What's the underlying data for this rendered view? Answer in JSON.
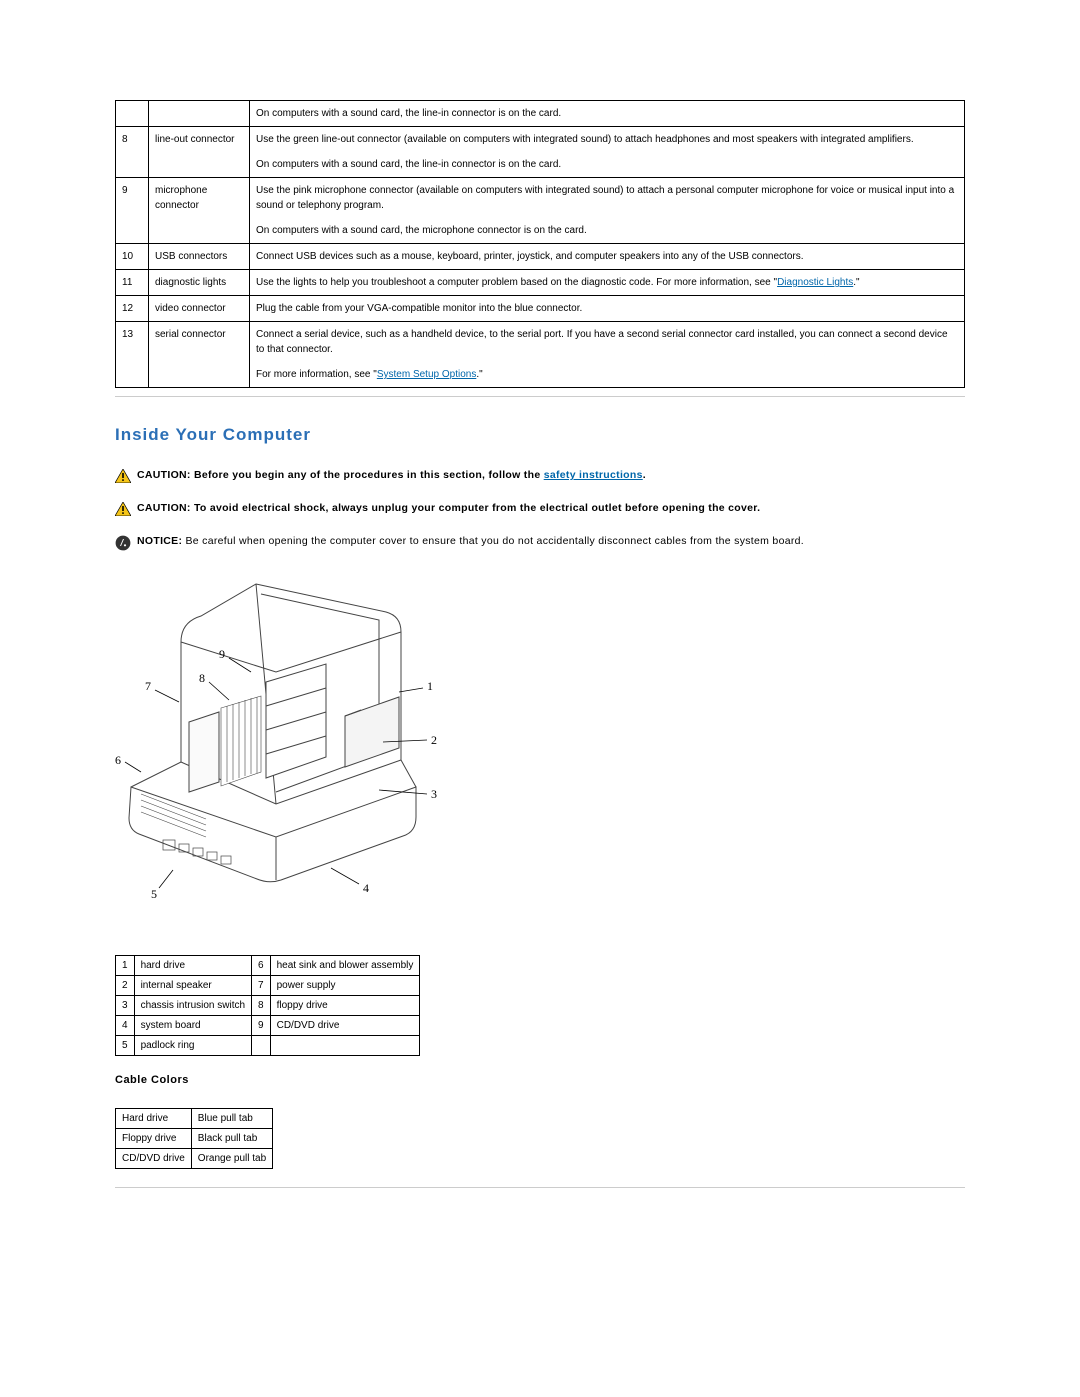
{
  "connector_rows": [
    {
      "num": "",
      "label": "",
      "desc_parts": [
        {
          "t": "text",
          "v": "On computers with a sound card, the line-in connector is on the card."
        }
      ]
    },
    {
      "num": "8",
      "label": "line-out connector",
      "desc_parts": [
        {
          "t": "text",
          "v": "Use the green line-out connector (available on computers with integrated sound) to attach headphones and most speakers with integrated amplifiers."
        },
        {
          "t": "br"
        },
        {
          "t": "text",
          "v": "On computers with a sound card, the line-in connector is on the card."
        }
      ]
    },
    {
      "num": "9",
      "label": "microphone connector",
      "desc_parts": [
        {
          "t": "text",
          "v": "Use the pink microphone connector (available on computers with integrated sound) to attach a personal computer microphone for voice or musical input into a sound or telephony program."
        },
        {
          "t": "br"
        },
        {
          "t": "text",
          "v": "On computers with a sound card, the microphone connector is on the card."
        }
      ]
    },
    {
      "num": "10",
      "label": "USB connectors",
      "desc_parts": [
        {
          "t": "text",
          "v": "Connect USB devices such as a mouse, keyboard, printer, joystick, and computer speakers into any of the USB connectors."
        }
      ]
    },
    {
      "num": "11",
      "label": "diagnostic lights",
      "desc_parts": [
        {
          "t": "text",
          "v": "Use the lights to help you troubleshoot a computer problem based on the diagnostic code. For more information, see \""
        },
        {
          "t": "link",
          "v": "Diagnostic Lights"
        },
        {
          "t": "text",
          "v": ".\""
        }
      ]
    },
    {
      "num": "12",
      "label": "video connector",
      "desc_parts": [
        {
          "t": "text",
          "v": "Plug the cable from your VGA-compatible monitor into the blue connector."
        }
      ]
    },
    {
      "num": "13",
      "label": "serial connector",
      "desc_parts": [
        {
          "t": "text",
          "v": "Connect a serial device, such as a handheld device, to the serial port. If you have a second serial connector card installed, you can connect a second device to that connector."
        },
        {
          "t": "br"
        },
        {
          "t": "text",
          "v": "For more information, see \""
        },
        {
          "t": "link",
          "v": "System Setup Options"
        },
        {
          "t": "text",
          "v": ".\""
        }
      ]
    }
  ],
  "section_heading": "Inside Your Computer",
  "caution1_label": "CAUTION: ",
  "caution1_pre": "Before you begin any of the procedures in this section, follow the ",
  "caution1_link": "safety instructions",
  "caution1_post": ".",
  "caution2_label": "CAUTION: ",
  "caution2_text": "To avoid electrical shock, always unplug your computer from the electrical outlet before opening the cover.",
  "notice_label": "NOTICE: ",
  "notice_text": "Be careful when opening the computer cover to ensure that you do not accidentally disconnect cables from the system board.",
  "parts_table": [
    {
      "n1": "1",
      "l1": "hard drive",
      "n2": "6",
      "l2": "heat sink and blower assembly"
    },
    {
      "n1": "2",
      "l1": "internal speaker",
      "n2": "7",
      "l2": "power supply"
    },
    {
      "n1": "3",
      "l1": "chassis intrusion switch",
      "n2": "8",
      "l2": "floppy drive"
    },
    {
      "n1": "4",
      "l1": "system board",
      "n2": "9",
      "l2": "CD/DVD drive"
    },
    {
      "n1": "5",
      "l1": "padlock ring",
      "n2": "",
      "l2": ""
    }
  ],
  "cable_heading": "Cable Colors",
  "cable_table": [
    {
      "drive": "Hard drive",
      "tab": "Blue pull tab"
    },
    {
      "drive": "Floppy drive",
      "tab": "Black pull tab"
    },
    {
      "drive": "CD/DVD drive",
      "tab": "Orange pull tab"
    }
  ],
  "callouts": {
    "c1": "1",
    "c2": "2",
    "c3": "3",
    "c4": "4",
    "c5": "5",
    "c6": "6",
    "c7": "7",
    "c8": "8",
    "c9": "9"
  }
}
